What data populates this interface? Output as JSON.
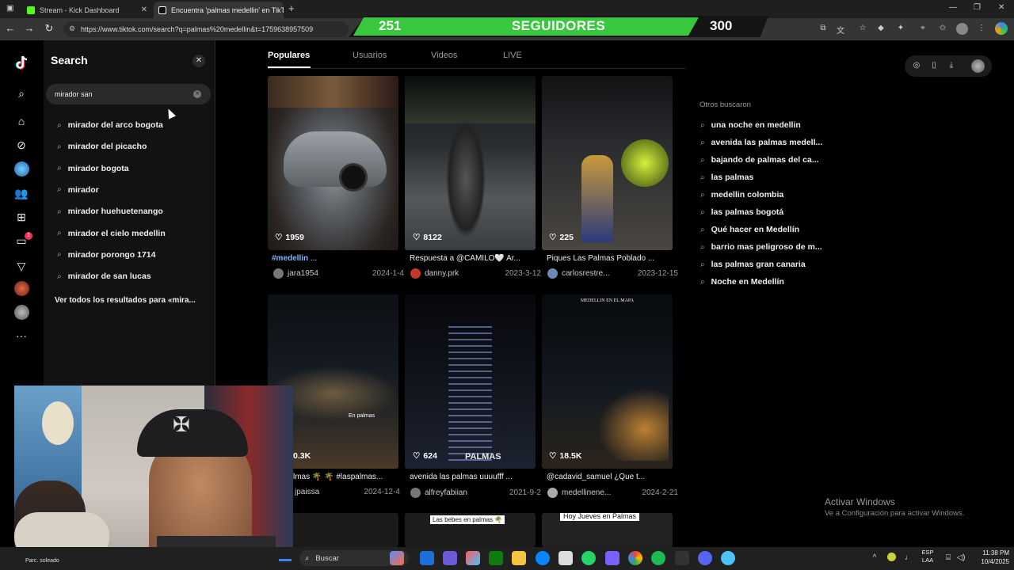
{
  "browser": {
    "tabs": [
      {
        "title": "Stream - Kick Dashboard",
        "favicon_color": "#53fc18"
      },
      {
        "title": "Encuentra 'palmas medellin' en TikTok",
        "favicon_color": "#ffffff"
      }
    ],
    "new_tab": "+",
    "url": "https://www.tiktok.com/search?q=palmas%20medellin&t=1759638957509"
  },
  "overlay": {
    "current": "251",
    "label": "SEGUIDORES",
    "goal": "300",
    "progress_fraction": 0.84,
    "colors": {
      "bar": "#37c83e",
      "track": "#141414"
    }
  },
  "search_panel": {
    "title": "Search",
    "query": "mirador san",
    "suggestions": [
      "mirador del arco bogota",
      "mirador del picacho",
      "mirador bogota",
      "mirador",
      "mirador huehuetenango",
      "mirador el cielo medellin",
      "mirador porongo 1714",
      "mirador de san lucas"
    ],
    "see_all": "Ver todos los resultados para «mira..."
  },
  "left_rail": {
    "notification_count": "1",
    "more": "···"
  },
  "content_tabs": [
    "Populares",
    "Usuarios",
    "Videos",
    "LIVE"
  ],
  "videos": [
    {
      "likes": "1959",
      "caption_tag": "#medellin",
      "caption": " ...",
      "user": "jara1954",
      "date": "2024-1-4"
    },
    {
      "likes": "8122",
      "caption_tag": "",
      "caption": "Respuesta a @CAMILO🤍 Ar...",
      "user": "danny.prk",
      "date": "2023-3-12"
    },
    {
      "likes": "225",
      "caption_tag": "",
      "caption": "Piques Las Palmas Poblado ...",
      "user": "carlosrestre...",
      "date": "2023-12-15"
    },
    {
      "likes": "0.3K",
      "caption_tag": "",
      "caption": "lmas 🌴 🌴 #laspalmas...",
      "user": "jpaissa",
      "date": "2024-12-4"
    },
    {
      "likes": "624",
      "caption_tag": "",
      "caption": "avenida las palmas uuuufff ...",
      "user": "alfreyfabiian",
      "date": "2021-9-2"
    },
    {
      "likes": "18.5K",
      "caption_tag": "",
      "caption": "@cadavid_samuel ¿Que t...",
      "user": "medellinene...",
      "date": "2024-2-21"
    }
  ],
  "thumb_texts": {
    "t4": "En palmas",
    "t5": "PALMAS",
    "t6": "MEDELLIN EN EL MAPA",
    "b2": "Las bebes en palmas 🌴",
    "b3": "Hoy Jueves en Palmas"
  },
  "others_searched": {
    "title": "Otros buscaron",
    "items": [
      "una noche en medellin",
      "avenida las palmas medell...",
      "bajando de palmas del ca...",
      "las palmas",
      "medellin colombia",
      "las palmas bogotá",
      "Qué hacer en Medellín",
      "barrio mas peligroso de m...",
      "las palmas gran canaria",
      "Noche en Medellín"
    ]
  },
  "watermark": {
    "title": "Activar Windows",
    "subtitle": "Ve a Configuración para activar Windows."
  },
  "taskbar": {
    "search_label": "Buscar",
    "lang_top": "ESP",
    "lang_bottom": "LAA",
    "time": "11:38 PM",
    "date": "10/4/2025",
    "weather": "Parc. soleado"
  }
}
